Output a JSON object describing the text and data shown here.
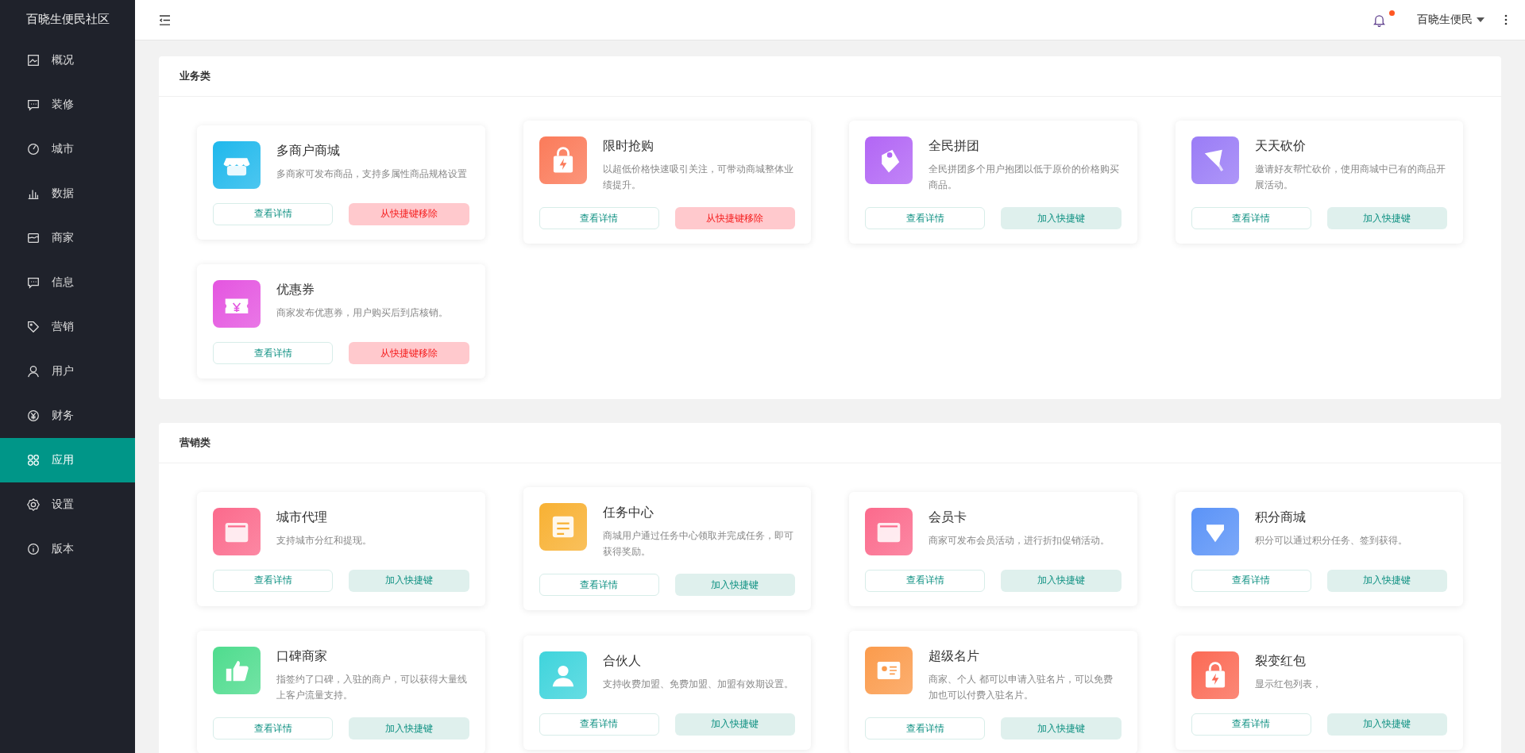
{
  "sidebar": {
    "title": "百晓生便民社区",
    "items": [
      {
        "label": "概况",
        "kind": "screen",
        "selected": false
      },
      {
        "label": "装修",
        "kind": "chat",
        "selected": false
      },
      {
        "label": "城市",
        "kind": "gauge",
        "selected": false
      },
      {
        "label": "数据",
        "kind": "bars",
        "selected": false
      },
      {
        "label": "商家",
        "kind": "shop",
        "selected": false
      },
      {
        "label": "信息",
        "kind": "chat",
        "selected": false
      },
      {
        "label": "营销",
        "kind": "tag",
        "selected": false
      },
      {
        "label": "用户",
        "kind": "user",
        "selected": false
      },
      {
        "label": "财务",
        "kind": "yen",
        "selected": false
      },
      {
        "label": "应用",
        "kind": "apps",
        "selected": true
      },
      {
        "label": "设置",
        "kind": "gear",
        "selected": false
      },
      {
        "label": "版本",
        "kind": "info",
        "selected": false
      }
    ]
  },
  "header": {
    "notification_dot": true,
    "user": "百晓生便民"
  },
  "sections": [
    {
      "title": "业务类",
      "apps": [
        {
          "name": "多商户商城",
          "description": "多商家可发布商品，支持多属性商品规格设置",
          "kind": "store",
          "color": "#1fb8ec",
          "details": "查看详情",
          "action": {
            "label": "从快捷键移除",
            "kind": "remove"
          }
        },
        {
          "name": "限时抢购",
          "description": "以超低价格快速吸引关注，可带动商城整体业绩提升。",
          "kind": "bag",
          "color": "#fb7b5a",
          "details": "查看详情",
          "action": {
            "label": "从快捷键移除",
            "kind": "remove"
          }
        },
        {
          "name": "全民拼团",
          "description": "全民拼团多个用户抱团以低于原价的价格购买商品。",
          "kind": "tag",
          "color": "#b266f5",
          "details": "查看详情",
          "action": {
            "label": "加入快捷键",
            "kind": "add"
          }
        },
        {
          "name": "天天砍价",
          "description": "邀请好友帮忙砍价，使用商城中已有的商品开展活动。",
          "kind": "megaphone",
          "color": "#9a7cf6",
          "details": "查看详情",
          "action": {
            "label": "加入快捷键",
            "kind": "add"
          }
        },
        {
          "name": "优惠券",
          "description": "商家发布优惠券，用户购买后到店核销。",
          "kind": "ticket",
          "color": "#e455e0",
          "details": "查看详情",
          "action": {
            "label": "从快捷键移除",
            "kind": "remove"
          }
        }
      ]
    },
    {
      "title": "营销类",
      "apps": [
        {
          "name": "城市代理",
          "description": "支持城市分红和提现。",
          "kind": "vip",
          "color": "#fb6a8c",
          "details": "查看详情",
          "action": {
            "label": "加入快捷键",
            "kind": "add"
          }
        },
        {
          "name": "任务中心",
          "description": "商城用户通过任务中心领取并完成任务，即可获得奖励。",
          "kind": "list",
          "color": "#f8b133",
          "details": "查看详情",
          "action": {
            "label": "加入快捷键",
            "kind": "add"
          }
        },
        {
          "name": "会员卡",
          "description": "商家可发布会员活动，进行折扣促销活动。",
          "kind": "vip",
          "color": "#fb6a8c",
          "details": "查看详情",
          "action": {
            "label": "加入快捷键",
            "kind": "add"
          }
        },
        {
          "name": "积分商城",
          "description": "积分可以通过积分任务、签到获得。",
          "kind": "diamond",
          "color": "#5b93f7",
          "details": "查看详情",
          "action": {
            "label": "加入快捷键",
            "kind": "add"
          }
        },
        {
          "name": "口碑商家",
          "description": "指签约了口碑，入驻的商户，可以获得大量线上客户流量支持。",
          "kind": "thumb",
          "color": "#4fdc8e",
          "details": "查看详情",
          "action": {
            "label": "加入快捷键",
            "kind": "add"
          }
        },
        {
          "name": "合伙人",
          "description": "支持收费加盟、免费加盟、加盟有效期设置。",
          "kind": "person",
          "color": "#3fd4dc",
          "details": "查看详情",
          "action": {
            "label": "加入快捷键",
            "kind": "add"
          }
        },
        {
          "name": "超级名片",
          "description": "商家、个人 都可以申请入驻名片，可以免费加也可以付费入驻名片。",
          "kind": "card",
          "color": "#fb9b4c",
          "details": "查看详情",
          "action": {
            "label": "加入快捷键",
            "kind": "add"
          }
        },
        {
          "name": "裂变红包",
          "description": "显示红包列表，",
          "kind": "bag",
          "color": "#fb6a55",
          "details": "查看详情",
          "action": {
            "label": "加入快捷键",
            "kind": "add"
          }
        }
      ]
    }
  ]
}
